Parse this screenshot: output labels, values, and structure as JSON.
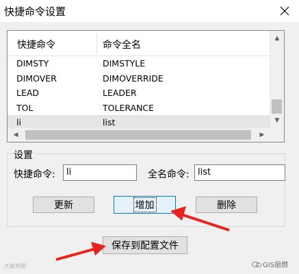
{
  "window": {
    "title": "快捷命令设置"
  },
  "list": {
    "headers": [
      "快捷命令",
      "命令全名"
    ],
    "rows": [
      {
        "short": "DIMSTY",
        "full": "DIMSTYLE"
      },
      {
        "short": "DIMOVER",
        "full": "DIMOVERRIDE"
      },
      {
        "short": "LEAD",
        "full": "LEADER"
      },
      {
        "short": "TOL",
        "full": "TOLERANCE"
      },
      {
        "short": "li",
        "full": "list"
      }
    ]
  },
  "settings": {
    "group_title": "设置",
    "shortcut_label": "快捷命令:",
    "shortcut_value": "li",
    "fullname_label": "全名命令:",
    "fullname_value": "list"
  },
  "buttons": {
    "update": "更新",
    "add": "增加",
    "delete": "删除",
    "save": "保存到配置文件"
  },
  "watermark": {
    "left": "大氣地图",
    "right": "GIS丽燃"
  },
  "colors": {
    "arrow": "#e8231e",
    "focus_border": "#0078d7"
  },
  "icons": {
    "close": "close-icon",
    "scroll_up": "chevron-up-icon",
    "scroll_down": "chevron-down-icon"
  }
}
